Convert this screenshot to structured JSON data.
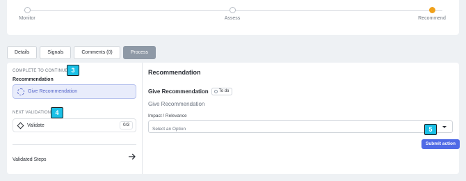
{
  "stepper": {
    "steps": [
      {
        "label": "Monitor",
        "state": "inactive"
      },
      {
        "label": "Assess",
        "state": "inactive"
      },
      {
        "label": "Recommend",
        "state": "active"
      }
    ]
  },
  "tabs": [
    {
      "label": "Details",
      "active": false
    },
    {
      "label": "Signals",
      "active": false
    },
    {
      "label": "Comments (0)",
      "active": false
    },
    {
      "label": "Process",
      "active": true
    }
  ],
  "left": {
    "complete_caption": "COMPLETE TO CONTINUE",
    "recommendation_label": "Recommendation",
    "give_recommendation": "Give Recommendation",
    "next_validation_caption": "NEXT VALIDATION",
    "validate_label": "Validate",
    "validate_count": "0/3",
    "validated_steps": "Validated Steps"
  },
  "right": {
    "title": "Recommendation",
    "give_heading": "Give Recommendation",
    "status": "To do",
    "give_sub": "Give Recommendation",
    "impact_label": "Impact / Relevance",
    "select_placeholder": "Select an Option",
    "submit_label": "Submit action"
  },
  "badges": {
    "b3": "3",
    "b4": "4",
    "b5": "5"
  },
  "colors": {
    "accent": "#4f6ae6",
    "active_step": "#f0a11b",
    "badge": "#1bc0e6"
  }
}
